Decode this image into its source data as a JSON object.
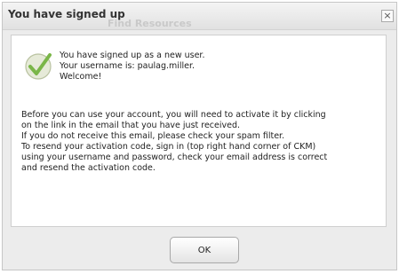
{
  "dialog": {
    "title": "You have signed up",
    "background_link_text": "Find Resources",
    "close_label": "×",
    "message_lines": [
      "You have signed up as a new user.",
      "Your username is: paulag.miller.",
      "Welcome!"
    ],
    "body_lines": [
      "Before you can use your account, you will need to activate it by clicking",
      "on the link in the email that you have just received.",
      "If you do not receive this email, please check your spam filter.",
      "To resend your activation code, sign in (top right hand corner of CKM)",
      "using your username and password, check your email address is correct",
      "and resend the activation code."
    ],
    "ok_label": "OK",
    "success_icon": "check-circle-icon"
  },
  "colors": {
    "check_green": "#7ab648",
    "check_circle": "#e6ead8",
    "dialog_bg": "#ececec"
  }
}
